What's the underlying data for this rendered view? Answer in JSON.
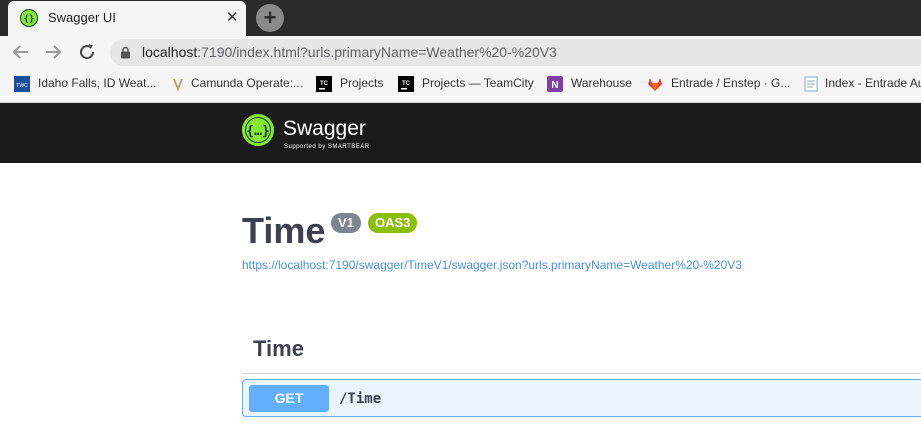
{
  "browser": {
    "tab_title": "Swagger UI",
    "close_glyph": "✕",
    "new_tab_glyph": "+",
    "url_host": "localhost",
    "url_rest": ":7190/index.html?urls.primaryName=Weather%20-%20V3"
  },
  "bookmarks": [
    {
      "label": "Idaho Falls, ID Weat...",
      "icon": "weather-channel-icon"
    },
    {
      "label": "Camunda Operate:...",
      "icon": "camunda-icon"
    },
    {
      "label": "Projects",
      "icon": "teamcity-icon"
    },
    {
      "label": "Projects — TeamCity",
      "icon": "teamcity-icon"
    },
    {
      "label": "Warehouse",
      "icon": "onenote-icon"
    },
    {
      "label": "Entrade / Enstep · G...",
      "icon": "gitlab-icon"
    },
    {
      "label": "Index - Entrade Au",
      "icon": "document-icon"
    }
  ],
  "swagger": {
    "brand": "Swagger",
    "brand_sub": "Supported by SMARTBEAR",
    "brand_color": "#85ea2d"
  },
  "api": {
    "title": "Time",
    "version_badge": "V1",
    "oas_badge": "OAS3",
    "spec_url": "https://localhost:7190/swagger/TimeV1/swagger.json?urls.primaryName=Weather%20-%20V3"
  },
  "section": {
    "tag": "Time",
    "operations": [
      {
        "method": "GET",
        "path": "/Time",
        "color": "#61affe"
      }
    ]
  }
}
